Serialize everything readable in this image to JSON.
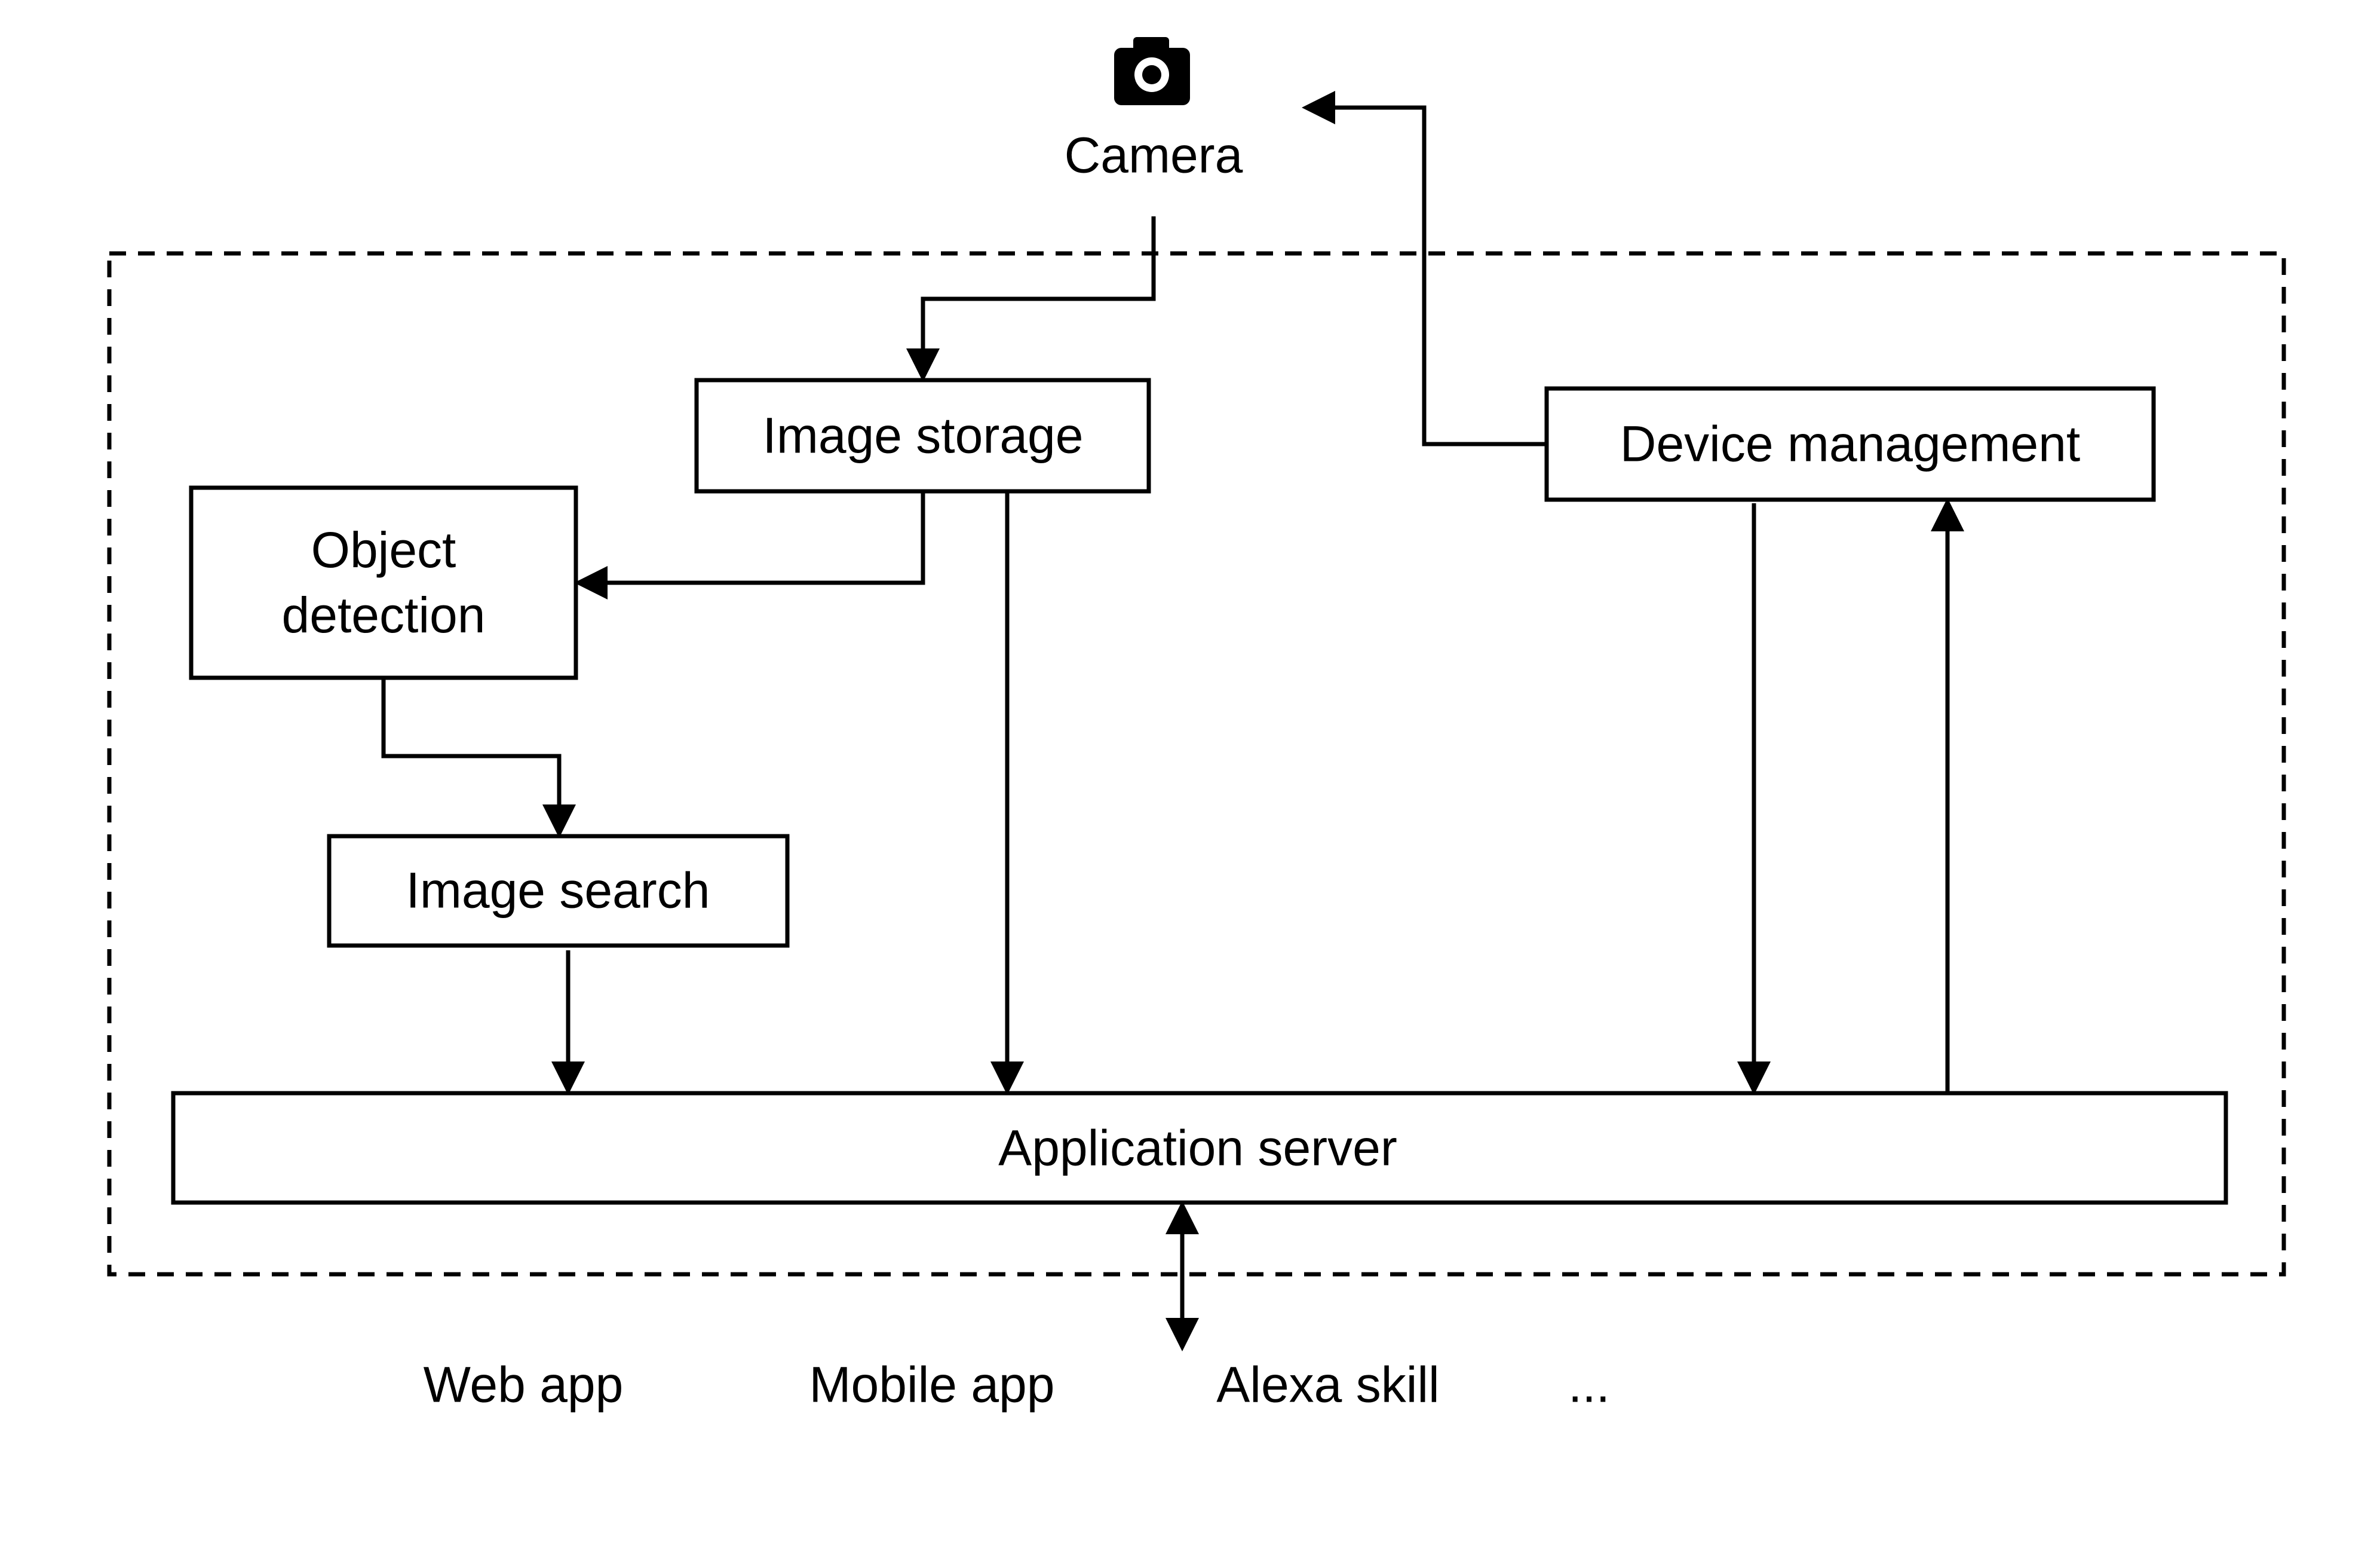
{
  "diagram": {
    "nodes": {
      "camera": "Camera",
      "image_storage": "Image storage",
      "object_detection": "Object detection",
      "device_management": "Device management",
      "image_search": "Image search",
      "application_server": "Application server"
    },
    "clients": [
      "Web app",
      "Mobile app",
      "Alexa skill",
      "..."
    ],
    "icons": {
      "camera": "camera-icon"
    },
    "colors": {
      "stroke": "#000000",
      "background": "#ffffff"
    },
    "edges": [
      {
        "from": "Camera",
        "to": "Image storage"
      },
      {
        "from": "Device management",
        "to": "Camera"
      },
      {
        "from": "Image storage",
        "to": "Object detection"
      },
      {
        "from": "Image storage",
        "to": "Application server"
      },
      {
        "from": "Object detection",
        "to": "Image search"
      },
      {
        "from": "Image search",
        "to": "Application server"
      },
      {
        "from": "Device management",
        "to": "Application server"
      },
      {
        "from": "Application server",
        "to": "Device management"
      },
      {
        "from": "Application server",
        "to": "clients",
        "bidirectional": true
      }
    ]
  }
}
